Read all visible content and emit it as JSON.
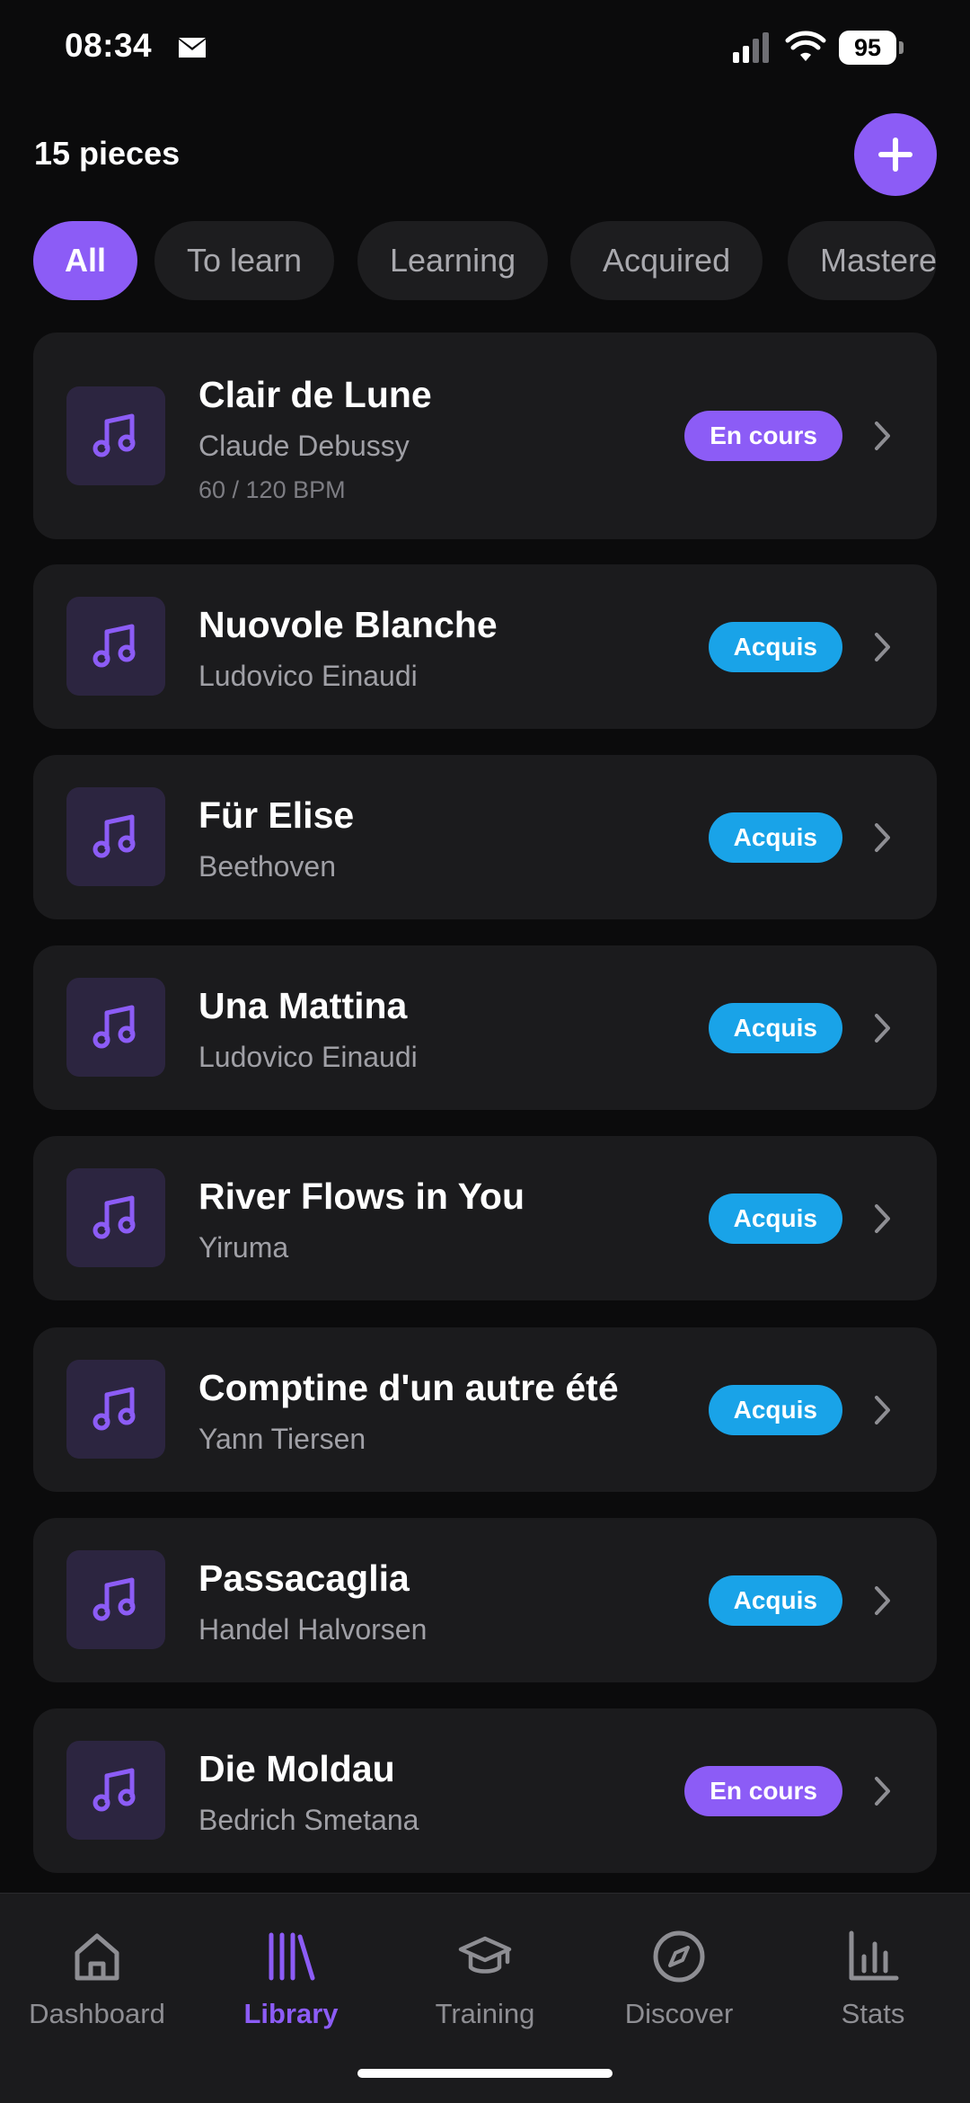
{
  "status_bar": {
    "time": "08:34",
    "battery": "95",
    "icons": [
      "mail-icon",
      "signal-icon",
      "wifi-icon",
      "battery-icon"
    ]
  },
  "header": {
    "count_label": "15 pieces",
    "add_icon": "plus-icon"
  },
  "filters": [
    {
      "label": "All",
      "active": true
    },
    {
      "label": "To learn",
      "active": false
    },
    {
      "label": "Learning",
      "active": false
    },
    {
      "label": "Acquired",
      "active": false
    },
    {
      "label": "Mastere",
      "active": false
    }
  ],
  "pieces": [
    {
      "title": "Clair de Lune",
      "artist": "Claude Debussy",
      "bpm": "60 / 120 BPM",
      "status": "En cours"
    },
    {
      "title": "Nuovole Blanche",
      "artist": "Ludovico Einaudi",
      "status": "Acquis"
    },
    {
      "title": "Für Elise",
      "artist": "Beethoven",
      "status": "Acquis"
    },
    {
      "title": "Una Mattina",
      "artist": "Ludovico Einaudi",
      "status": "Acquis"
    },
    {
      "title": "River Flows in You",
      "artist": "Yiruma",
      "status": "Acquis"
    },
    {
      "title": "Comptine d'un autre été",
      "artist": "Yann Tiersen",
      "status": "Acquis"
    },
    {
      "title": "Passacaglia",
      "artist": "Handel Halvorsen",
      "status": "Acquis"
    },
    {
      "title": "Die Moldau",
      "artist": "Bedrich Smetana",
      "status": "En cours"
    }
  ],
  "nav": [
    {
      "label": "Dashboard",
      "icon": "home-icon",
      "active": false
    },
    {
      "label": "Library",
      "icon": "library-icon",
      "active": true
    },
    {
      "label": "Training",
      "icon": "graduation-cap-icon",
      "active": false
    },
    {
      "label": "Discover",
      "icon": "compass-icon",
      "active": false
    },
    {
      "label": "Stats",
      "icon": "bar-chart-icon",
      "active": false
    }
  ],
  "colors": {
    "background": "#0b0b0c",
    "card": "#1b1b1d",
    "accent_purple": "#8c5cf6",
    "badge_blue": "#19a3e8",
    "thumb_bg": "#2c2540"
  }
}
